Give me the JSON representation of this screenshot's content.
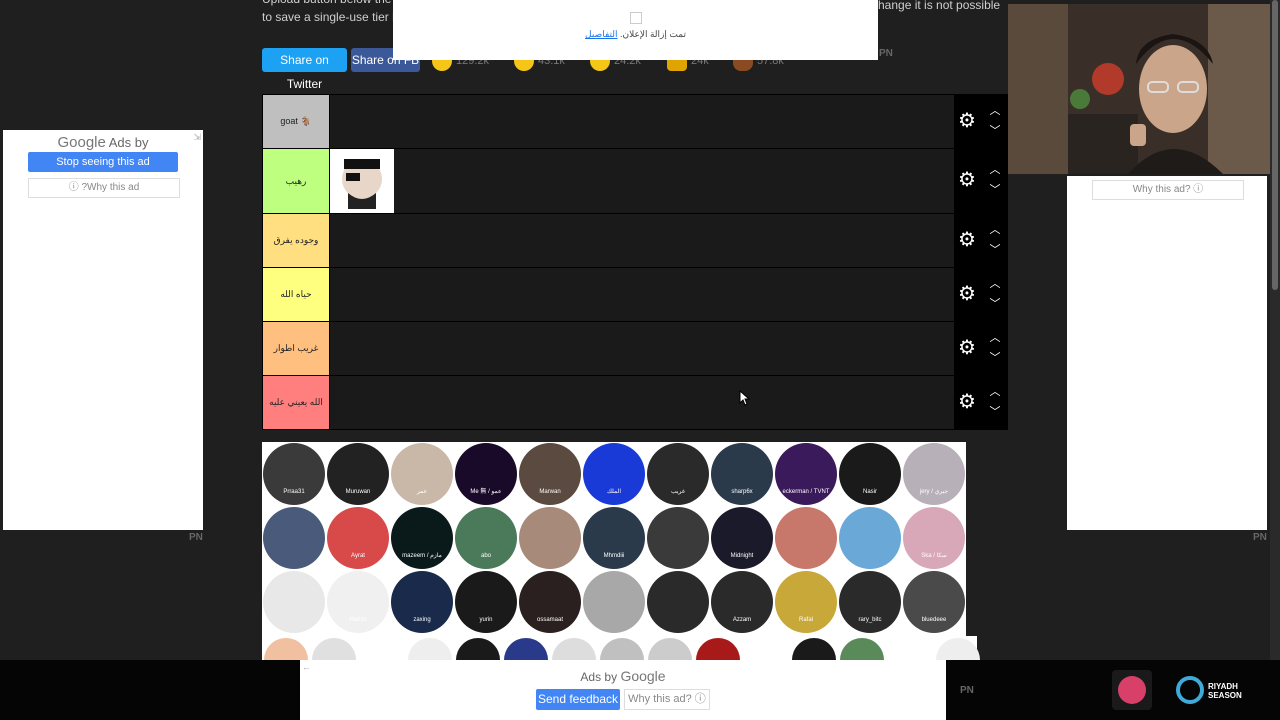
{
  "intro": {
    "line1": "Upload button below the ...",
    "line2": "to save a single-use tier lis",
    "line1_tail": "hange it is not possible"
  },
  "share": {
    "twitter": "Share on Twitter",
    "facebook": "Share on FB",
    "reactions": [
      {
        "icon": "grin-emoji",
        "count": "129.2k"
      },
      {
        "icon": "heart-eyes-emoji",
        "count": "43.1k"
      },
      {
        "icon": "laugh-tears-emoji",
        "count": "24.2k"
      },
      {
        "icon": "raised-hands-emoji",
        "count": "24k"
      },
      {
        "icon": "poop-emoji",
        "count": "57.8k"
      }
    ]
  },
  "top_ad": {
    "message": "تمت إزالة الإعلان.",
    "details": "التفاصيل",
    "badge": "PN"
  },
  "tiers": [
    {
      "label": "goat 🐐",
      "color": "#bfbfbf"
    },
    {
      "label": "رهيب",
      "color": "#bfff7f"
    },
    {
      "label": "وجوده يفرق",
      "color": "#ffdf7f"
    },
    {
      "label": "حياه الله",
      "color": "#ffff7f"
    },
    {
      "label": "غريب اطوار",
      "color": "#ffbf7f"
    },
    {
      "label": "الله يعيني عليه",
      "color": "#ff7f7f"
    }
  ],
  "pool_labels": [
    "Prraa31",
    "Muruwan",
    "عمر",
    "Me 無 / عمو",
    "Marwan",
    "الملك",
    "غريب",
    "sharp6x",
    "eckerman / TVNT",
    "Nasir",
    "jery / جيري",
    "",
    "Ayrat",
    "mazeem / مازم",
    "abo",
    "",
    "Mhmdiii",
    "",
    "Midnight",
    "",
    "",
    "Ska / سكا",
    "",
    "Hanzo",
    "zaxing",
    "yurin",
    "ossamaat",
    "",
    "",
    "Azzam",
    "Rafal",
    "rary_bitc",
    "bluedeee"
  ],
  "left_ad": {
    "google": "Google",
    "ads_by": "Ads by",
    "stop": "Stop seeing this ad",
    "why": "ⓘ ?Why this ad",
    "badge": "PN"
  },
  "right_ad": {
    "why": "Why this ad? ⓘ",
    "badge": "PN"
  },
  "bottom_ad": {
    "ads_by": "Ads by",
    "google": "Google",
    "feedback": "Send feedback",
    "why": "Why this ad? ⓘ",
    "badge": "PN"
  },
  "bottom_bar": {
    "logo_text": "RIYADH\nSEASON"
  }
}
